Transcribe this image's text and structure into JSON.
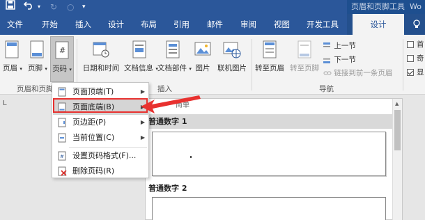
{
  "titlebar": {
    "save_icon": "save-icon",
    "undo_icon": "undo-icon",
    "contextual_title": "页眉和页脚工具",
    "contextual_suffix": "Wo"
  },
  "tabs": {
    "file": "文件",
    "home": "开始",
    "insert": "插入",
    "design": "设计",
    "layout": "布局",
    "references": "引用",
    "mailings": "邮件",
    "review": "审阅",
    "view": "视图",
    "developer": "开发工具",
    "hf_design": "设计"
  },
  "ribbon": {
    "header_label": "页眉",
    "footer_label": "页脚",
    "pagenum_label": "页码",
    "datetime_label": "日期和时间",
    "docinfo_label": "文档信息",
    "docparts_label": "文档部件",
    "picture_label": "图片",
    "online_picture_label": "联机图片",
    "goto_header_label": "转至页眉",
    "goto_footer_label": "转至页脚",
    "prev_section_label": "上一节",
    "next_section_label": "下一节",
    "link_previous_label": "链接到前一条页眉",
    "group_hf": "页眉和页脚",
    "group_insert": "插入",
    "group_nav": "导航",
    "options": [
      {
        "label": "首",
        "checked": false
      },
      {
        "label": "奇",
        "checked": false
      },
      {
        "label": "显",
        "checked": true
      }
    ]
  },
  "menu": {
    "items": [
      {
        "label": "页面顶端(T)",
        "icon": "page-top-icon",
        "submenu": true
      },
      {
        "label": "页面底端(B)",
        "icon": "page-bottom-icon",
        "submenu": true
      },
      {
        "label": "页边距(P)",
        "icon": "page-margin-icon",
        "submenu": true
      },
      {
        "label": "当前位置(C)",
        "icon": "current-position-icon",
        "submenu": true
      },
      {
        "label": "设置页码格式(F)...",
        "icon": "format-page-number-icon",
        "submenu": false
      },
      {
        "label": "删除页码(R)",
        "icon": "remove-page-number-icon",
        "submenu": false
      }
    ]
  },
  "gallery": {
    "top_label": "简单",
    "section1": "普通数字 1",
    "section2": "普通数字 2"
  },
  "ruler_mark": "L"
}
